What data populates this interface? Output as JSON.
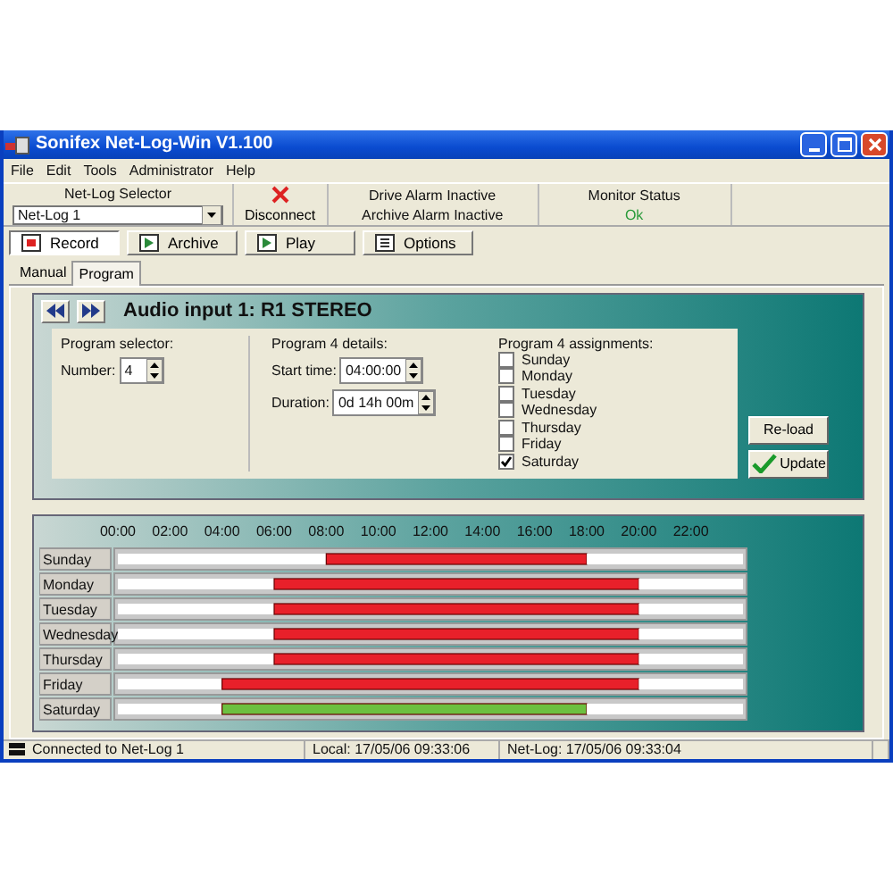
{
  "window": {
    "title": "Sonifex Net-Log-Win V1.100"
  },
  "menu": [
    "File",
    "Edit",
    "Tools",
    "Administrator",
    "Help"
  ],
  "toolbar": {
    "selector_label": "Net-Log Selector",
    "selector_value": "Net-Log 1",
    "disconnect": "Disconnect",
    "alarms": [
      "Drive Alarm Inactive",
      "Archive Alarm Inactive"
    ],
    "monitor_label": "Monitor Status",
    "monitor_value": "Ok"
  },
  "tabs": [
    {
      "label": "Record",
      "selected": true
    },
    {
      "label": "Archive",
      "selected": false
    },
    {
      "label": "Play",
      "selected": false
    },
    {
      "label": "Options",
      "selected": false
    }
  ],
  "subtabs": [
    {
      "label": "Manual",
      "selected": false
    },
    {
      "label": "Program",
      "selected": true
    }
  ],
  "program": {
    "title": "Audio input 1:  R1 STEREO",
    "selector": {
      "title": "Program selector:",
      "number_label": "Number:",
      "number": "4"
    },
    "details": {
      "title": "Program 4 details:",
      "start_label": "Start time:",
      "start": "04:00:00",
      "duration_label": "Duration:",
      "duration": "0d 14h 00m"
    },
    "assignments": {
      "title": "Program 4 assignments:",
      "days": [
        {
          "label": "Sunday",
          "checked": false
        },
        {
          "label": "Monday",
          "checked": false
        },
        {
          "label": "Tuesday",
          "checked": false
        },
        {
          "label": "Wednesday",
          "checked": false
        },
        {
          "label": "Thursday",
          "checked": false
        },
        {
          "label": "Friday",
          "checked": false
        },
        {
          "label": "Saturday",
          "checked": true
        }
      ]
    },
    "buttons": [
      "Re-load",
      "Update"
    ]
  },
  "schedule": {
    "chart_data": {
      "type": "bar",
      "orientation": "horizontal",
      "stacked": true,
      "categories": [
        "Sunday",
        "Monday",
        "Tuesday",
        "Wednesday",
        "Thursday",
        "Friday",
        "Saturday"
      ],
      "xlim": [
        0,
        24
      ],
      "xticks": [
        {
          "value": 0,
          "label": "00:00"
        },
        {
          "value": 2,
          "label": "02:00"
        },
        {
          "value": 4,
          "label": "04:00"
        },
        {
          "value": 6,
          "label": "06:00"
        },
        {
          "value": 8,
          "label": "08:00"
        },
        {
          "value": 10,
          "label": "10:00"
        },
        {
          "value": 12,
          "label": "12:00"
        },
        {
          "value": 14,
          "label": "14:00"
        },
        {
          "value": 16,
          "label": "16:00"
        },
        {
          "value": 18,
          "label": "18:00"
        },
        {
          "value": 20,
          "label": "20:00"
        },
        {
          "value": 22,
          "label": "22:00"
        }
      ],
      "series": [
        {
          "color": "#ffffff",
          "values": [
            8,
            6,
            6,
            6,
            6,
            4,
            4
          ]
        },
        {
          "color": "#e8202a",
          "values": [
            10,
            14,
            14,
            14,
            14,
            16,
            null
          ]
        },
        {
          "color": "#6cc040",
          "values": [
            null,
            null,
            null,
            null,
            null,
            null,
            14
          ]
        },
        {
          "color": "#ffffff",
          "values": [
            6,
            4,
            4,
            4,
            4,
            4,
            6
          ]
        }
      ]
    }
  },
  "status_bar": [
    "Connected to Net-Log 1",
    "Local: 17/05/06 09:33:06",
    "Net-Log: 17/05/06 09:33:04"
  ]
}
